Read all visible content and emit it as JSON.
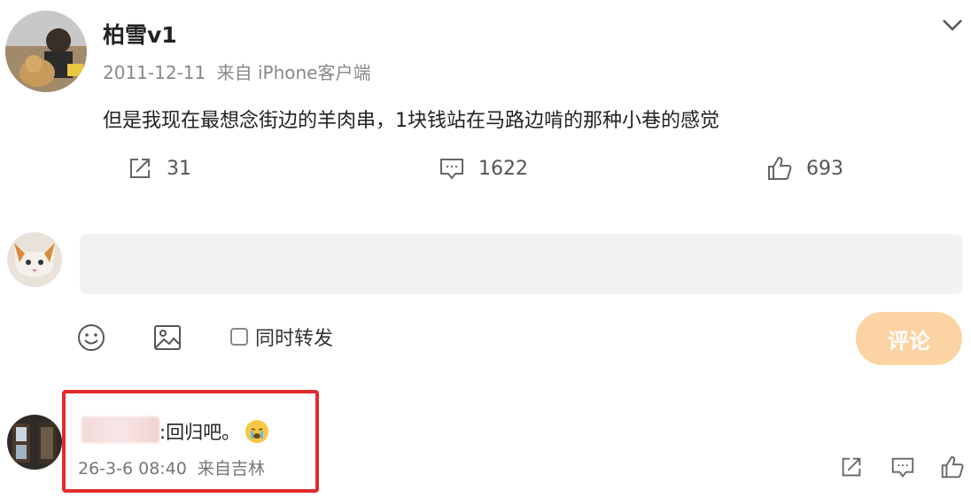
{
  "post": {
    "username": "柏雪v1",
    "date": "2011-12-11",
    "source": "来自 iPhone客户端",
    "text": "但是我现在最想念街边的羊肉串，1块钱站在马路边啃的那种小巷的感觉",
    "repost_count": "31",
    "comment_count": "1622",
    "like_count": "693"
  },
  "composer": {
    "repost_checkbox_label": "同时转发",
    "submit_label": "评论"
  },
  "reply": {
    "text": ":回归吧。",
    "date": "26-3-6 08:40",
    "source": "来自吉林"
  },
  "colors": {
    "submit_bg": "#fcd3a2",
    "highlight_border": "#e32b2b"
  },
  "icons": {
    "expand": "chevron-down-icon",
    "repost": "share-icon",
    "comment": "comment-icon",
    "like": "thumbs-up-icon",
    "emoji": "smiley-icon",
    "image": "image-icon",
    "reply_emoji": "crying-face-icon"
  }
}
